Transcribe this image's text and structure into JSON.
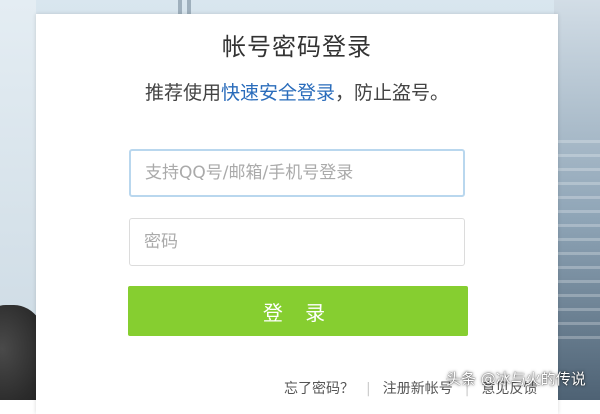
{
  "login": {
    "title": "帐号密码登录",
    "subtitle_prefix": "推荐使用",
    "subtitle_link": "快速安全登录",
    "subtitle_suffix": "，防止盗号。",
    "account_placeholder": "支持QQ号/邮箱/手机号登录",
    "password_placeholder": "密码",
    "login_button": "登 录"
  },
  "footer": {
    "forgot_password": "忘了密码？",
    "register": "注册新帐号",
    "feedback": "意见反馈"
  },
  "watermark": {
    "text": "头条 @冰与火的传说"
  },
  "colors": {
    "button": "#86ce30",
    "link": "#2a6cbb",
    "focus_border": "#b9d7ee"
  }
}
